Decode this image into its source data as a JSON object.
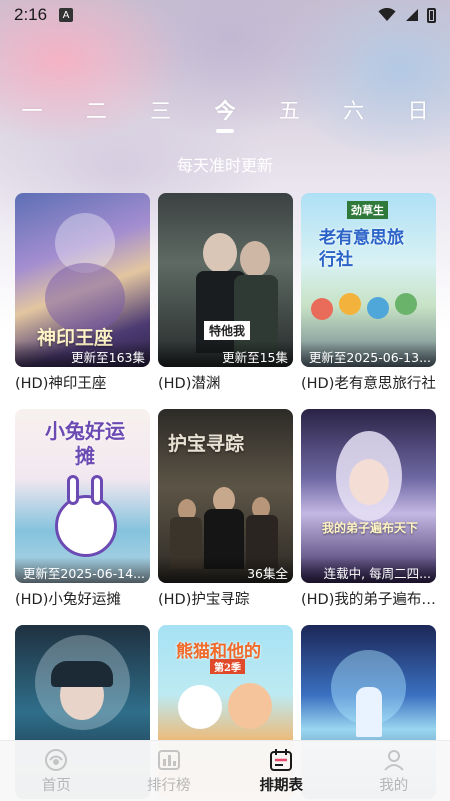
{
  "status_bar": {
    "time": "2:16",
    "notification_icon": "A"
  },
  "weekdays": [
    {
      "label": "一",
      "active": false
    },
    {
      "label": "二",
      "active": false
    },
    {
      "label": "三",
      "active": false
    },
    {
      "label": "今",
      "active": true
    },
    {
      "label": "五",
      "active": false
    },
    {
      "label": "六",
      "active": false
    },
    {
      "label": "日",
      "active": false
    }
  ],
  "subtitle": "每天准时更新",
  "shows": [
    {
      "title": "(HD)神印王座",
      "tag": "更新至163集"
    },
    {
      "title": "(HD)潜渊",
      "tag": "更新至15集"
    },
    {
      "title": "(HD)老有意思旅行社",
      "tag": "更新至2025-06-13..."
    },
    {
      "title": "(HD)小兔好运摊",
      "tag": "更新至2025-06-14..."
    },
    {
      "title": "(HD)护宝寻踪",
      "tag": "36集全"
    },
    {
      "title": "(HD)我的弟子遍布天下",
      "tag": "连载中, 每周二四..."
    },
    {
      "title": "",
      "tag": ""
    },
    {
      "title": "",
      "tag": ""
    },
    {
      "title": "",
      "tag": ""
    }
  ],
  "poster_art": {
    "p1": "神印王座",
    "p2": "特他我",
    "p3": "老有意思旅行社",
    "p3_brand": "劲草生",
    "p4": "小兔好运摊",
    "p5": "护宝寻踪",
    "p6": "我的弟子遍布天下",
    "p8": "熊猫和他的",
    "p8_sub": "第2季"
  },
  "bottom_nav": {
    "items": [
      {
        "label": "首页",
        "icon": "home-icon",
        "active": false
      },
      {
        "label": "排行榜",
        "icon": "ranking-icon",
        "active": false
      },
      {
        "label": "排期表",
        "icon": "calendar-icon",
        "active": true
      },
      {
        "label": "我的",
        "icon": "profile-icon",
        "active": false
      }
    ]
  },
  "colors": {
    "active_text": "#1a1a1a",
    "inactive_text": "#b7b7b7",
    "accent_white": "#ffffff"
  }
}
